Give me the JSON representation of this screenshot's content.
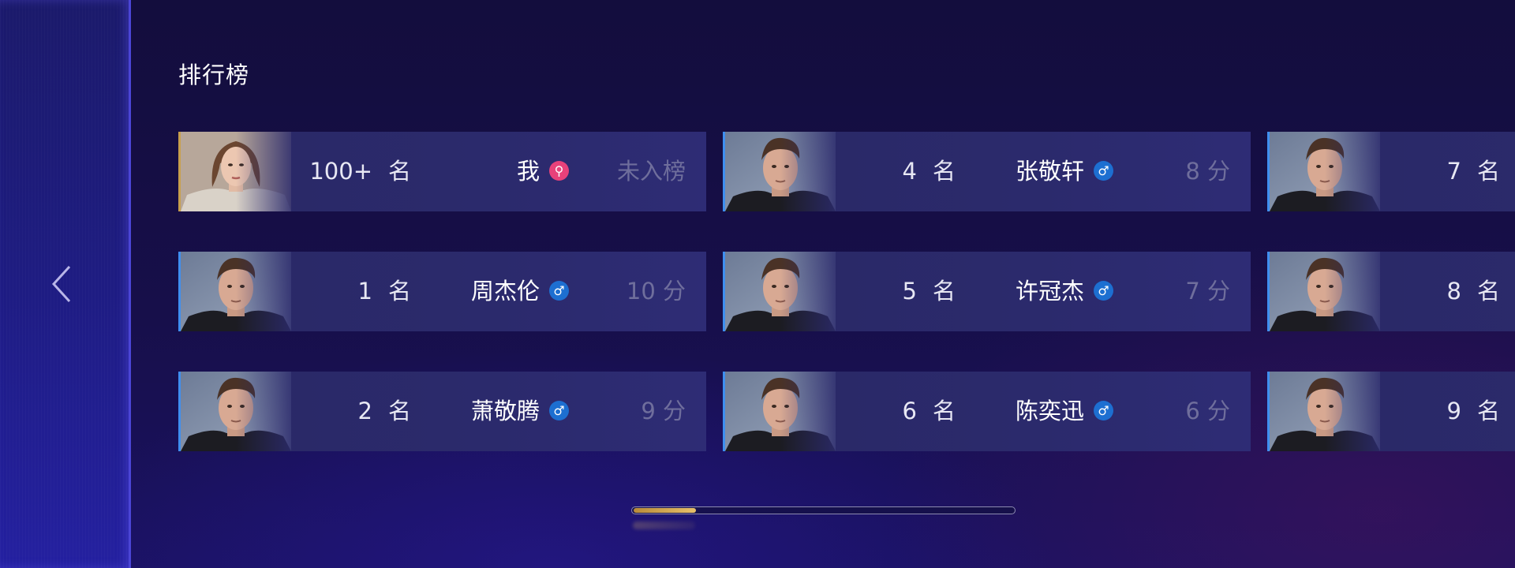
{
  "page": {
    "title": "排行榜"
  },
  "icons": {
    "back": "chevron-left-icon",
    "male": "male-icon",
    "female": "female-icon"
  },
  "colors": {
    "accent_bar": "#3f8ff0",
    "me_accent": "#c8a04e",
    "male_badge": "#1d6fd1",
    "female_badge": "#e8417a",
    "scroll_thumb": "#e7c06a"
  },
  "rank_unit": "名",
  "cards": [
    {
      "rank": "100+",
      "name": "我",
      "gender": "female",
      "gender_symbol": "⚲",
      "score": "未入榜",
      "avatar": "female-portrait",
      "is_me": true
    },
    {
      "rank": "1",
      "name": "周杰伦",
      "gender": "male",
      "gender_symbol": "♂",
      "score": "10 分",
      "avatar": "male-portrait"
    },
    {
      "rank": "2",
      "name": "萧敬腾",
      "gender": "male",
      "gender_symbol": "♂",
      "score": "9 分",
      "avatar": "male-portrait"
    },
    {
      "rank": "4",
      "name": "张敬轩",
      "gender": "male",
      "gender_symbol": "♂",
      "score": "8 分",
      "avatar": "male-portrait"
    },
    {
      "rank": "5",
      "name": "许冠杰",
      "gender": "male",
      "gender_symbol": "♂",
      "score": "7 分",
      "avatar": "male-portrait"
    },
    {
      "rank": "6",
      "name": "陈奕迅",
      "gender": "male",
      "gender_symbol": "♂",
      "score": "6 分",
      "avatar": "male-portrait"
    },
    {
      "rank": "7",
      "name": "",
      "gender": "",
      "gender_symbol": "",
      "score": "",
      "avatar": "male-portrait"
    },
    {
      "rank": "8",
      "name": "",
      "gender": "",
      "gender_symbol": "",
      "score": "",
      "avatar": "male-portrait"
    },
    {
      "rank": "9",
      "name": "",
      "gender": "",
      "gender_symbol": "",
      "score": "",
      "avatar": "male-portrait"
    }
  ],
  "scrollbar": {
    "progress_fraction": 0.17
  }
}
